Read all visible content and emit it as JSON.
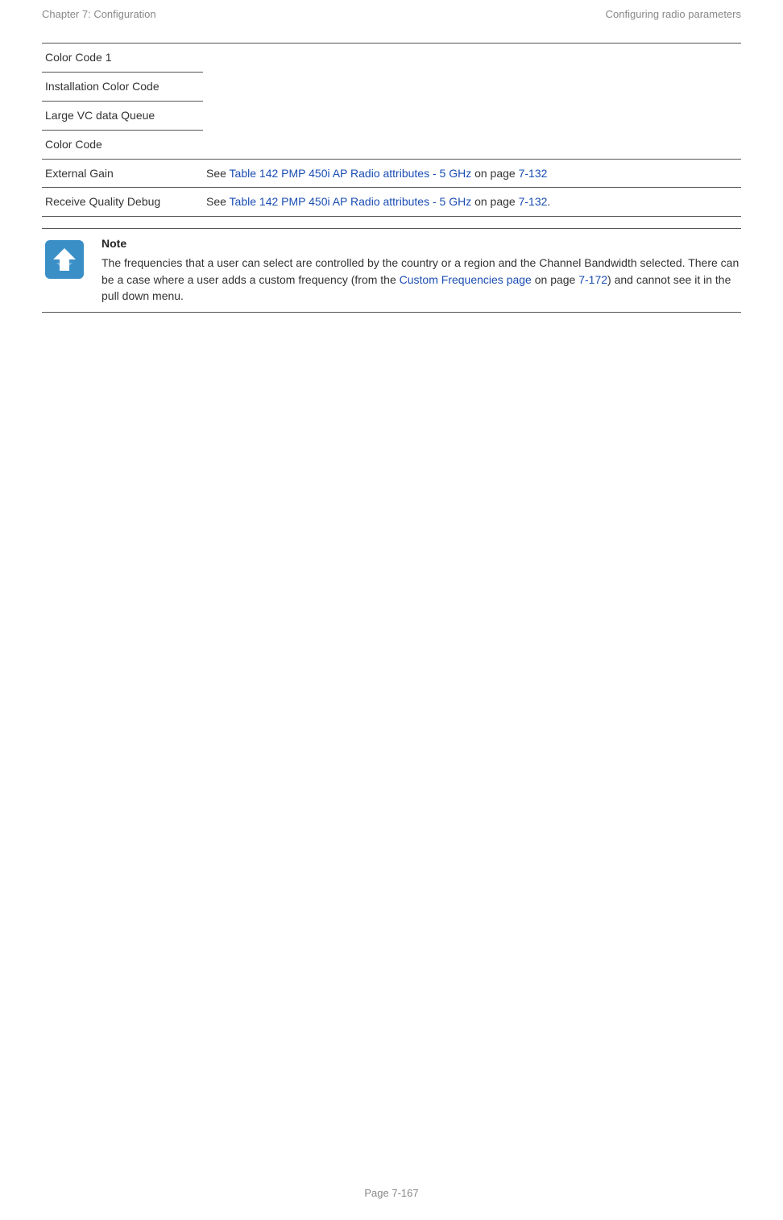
{
  "header": {
    "left": "Chapter 7:  Configuration",
    "right": "Configuring radio parameters"
  },
  "table": {
    "rows": {
      "color_code_1": "Color Code 1",
      "installation_color_code": "Installation Color Code",
      "large_vc": "Large VC data Queue",
      "color_code": "Color Code",
      "external_gain": {
        "label": "External Gain",
        "see": "See ",
        "link": "Table 142 PMP 450i AP Radio attributes - 5 GHz ",
        "onpage": " on page ",
        "pagenum": "7-132"
      },
      "receive_quality": {
        "label": "Receive Quality Debug",
        "see": "See ",
        "link": "Table 142 PMP 450i AP Radio attributes - 5 GHz ",
        "onpage": " on page ",
        "pagenum": "7-132",
        "period": "."
      }
    }
  },
  "note": {
    "title": "Note",
    "text_part1": "The frequencies that a user can select are controlled by the country or a region and the Channel Bandwidth selected. There can be a case where a user adds a custom frequency (from the ",
    "link_text": "Custom Frequencies page",
    "mid": " on page ",
    "pagenum": "7-172",
    "text_part2": ") and cannot see it in the pull down menu."
  },
  "footer": "Page 7-167"
}
